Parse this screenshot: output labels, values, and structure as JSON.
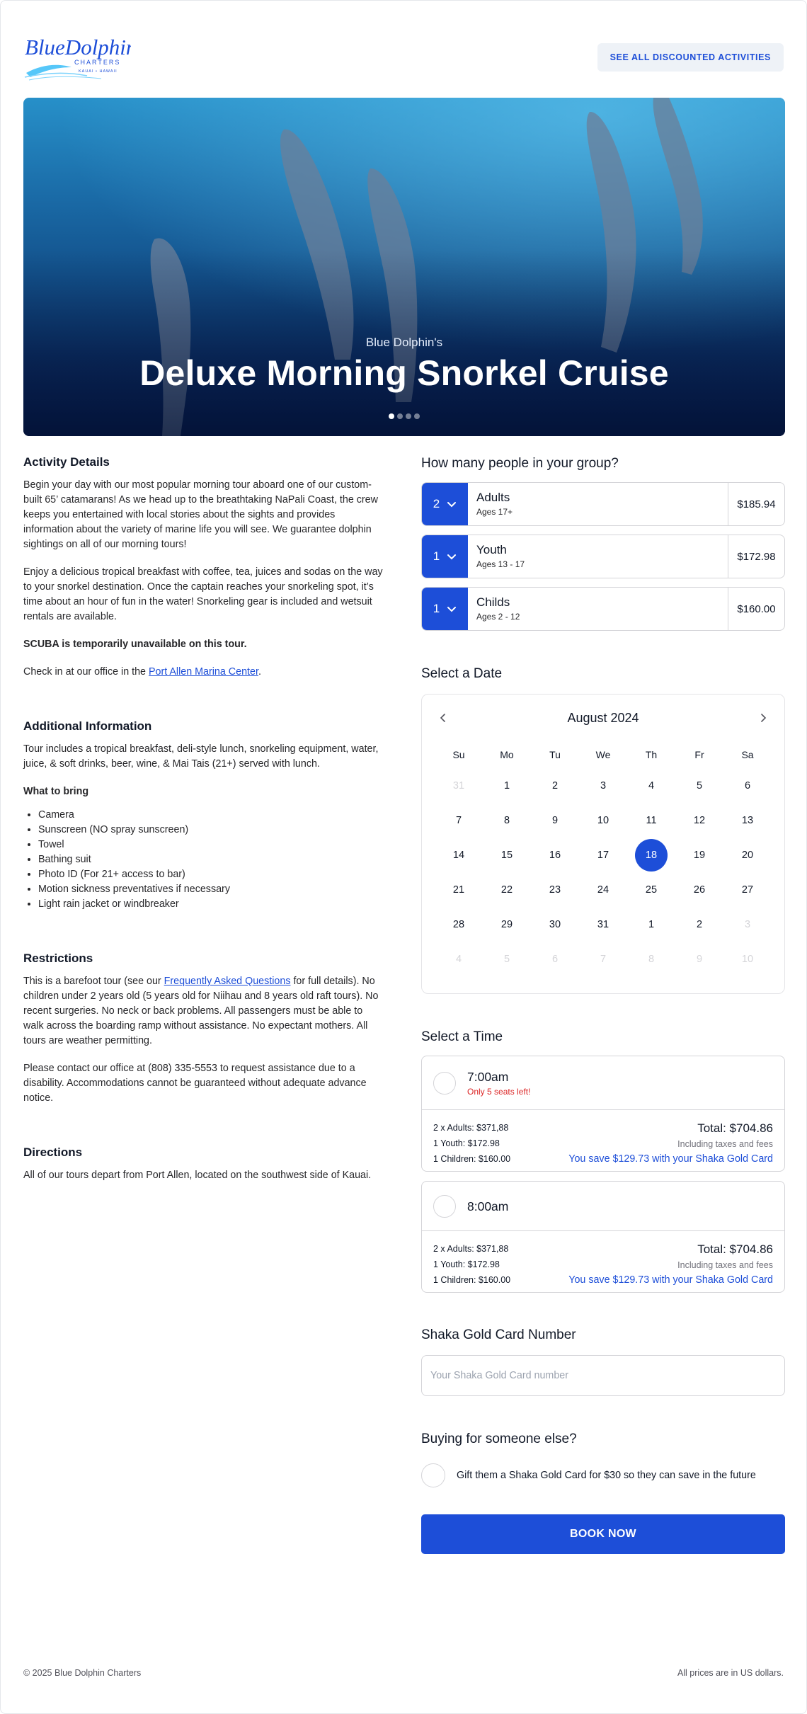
{
  "header": {
    "logo_text": "BlueDolphin",
    "logo_sub": "CHARTERS",
    "logo_tag": "KAUAI • HAWAII",
    "discount_button": "SEE ALL DISCOUNTED ACTIVITIES"
  },
  "hero": {
    "subtitle": "Blue Dolphin's",
    "title": "Deluxe Morning Snorkel Cruise",
    "slide_count": 4,
    "active_slide": 1
  },
  "details": {
    "activity_heading": "Activity Details",
    "p1": "Begin your day with our most popular morning tour aboard one of our custom-built 65’ catamarans! As we head up to the breathtaking NaPali Coast, the crew keeps you entertained with local stories about the sights and provides information about the variety of marine life you will see. We guarantee dolphin sightings on all of our morning tours!",
    "p2": "Enjoy a delicious tropical breakfast with coffee, tea, juices and sodas on the way to your snorkel destination. Once the captain reaches your snorkeling spot, it’s time about an hour of fun in the water! Snorkeling gear is included and wetsuit rentals are available.",
    "scuba_note": "SCUBA is temporarily unavailable on this tour.",
    "checkin_prefix": "Check in at our office in the ",
    "checkin_link": "Port Allen Marina Center",
    "checkin_suffix": ".",
    "additional_heading": "Additional Information",
    "additional_text": "Tour includes a tropical breakfast, deli-style lunch, snorkeling equipment, water, juice, & soft drinks, beer, wine, & Mai Tais (21+) served with lunch.",
    "bring_heading": "What to bring",
    "bring_items": [
      "Camera",
      "Sunscreen (NO spray sunscreen)",
      "Towel",
      "Bathing suit",
      "Photo ID (For 21+ access to bar)",
      "Motion sickness preventatives if necessary",
      "Light rain jacket or windbreaker"
    ],
    "restrictions_heading": "Restrictions",
    "restrictions_prefix": "This is a barefoot tour (see our ",
    "restrictions_link": "Frequently Asked Questions",
    "restrictions_suffix": " for full details). No children under 2 years old (5 years old for Niihau and 8 years old raft tours). No recent surgeries. No neck or back problems. All passengers must be able to walk across the boarding ramp without assistance. No expectant mothers. All tours are weather permitting.",
    "contact_text": "Please contact our office at (808) 335-5553 to request assistance due to a disability. Accommodations cannot be guaranteed without adequate advance notice.",
    "directions_heading": "Directions",
    "directions_text": "All of our tours depart from Port Allen, located on the southwest side of Kauai."
  },
  "group": {
    "heading": "How many people in your group?",
    "rows": [
      {
        "qty": "2",
        "name": "Adults",
        "ages": "Ages 17+",
        "price": "$185.94"
      },
      {
        "qty": "1",
        "name": "Youth",
        "ages": "Ages 13 - 17",
        "price": "$172.98"
      },
      {
        "qty": "1",
        "name": "Childs",
        "ages": "Ages 2 - 12",
        "price": "$160.00"
      }
    ]
  },
  "date": {
    "heading": "Select a Date",
    "month": "August 2024",
    "weekdays": [
      "Su",
      "Mo",
      "Tu",
      "We",
      "Th",
      "Fr",
      "Sa"
    ],
    "days": [
      {
        "d": "31",
        "muted": true
      },
      {
        "d": "1"
      },
      {
        "d": "2"
      },
      {
        "d": "3"
      },
      {
        "d": "4"
      },
      {
        "d": "5"
      },
      {
        "d": "6"
      },
      {
        "d": "7"
      },
      {
        "d": "8"
      },
      {
        "d": "9"
      },
      {
        "d": "10"
      },
      {
        "d": "11"
      },
      {
        "d": "12"
      },
      {
        "d": "13"
      },
      {
        "d": "14"
      },
      {
        "d": "15"
      },
      {
        "d": "16"
      },
      {
        "d": "17"
      },
      {
        "d": "18",
        "selected": true
      },
      {
        "d": "19"
      },
      {
        "d": "20"
      },
      {
        "d": "21"
      },
      {
        "d": "22"
      },
      {
        "d": "23"
      },
      {
        "d": "24"
      },
      {
        "d": "25"
      },
      {
        "d": "26"
      },
      {
        "d": "27"
      },
      {
        "d": "28"
      },
      {
        "d": "29"
      },
      {
        "d": "30"
      },
      {
        "d": "31"
      },
      {
        "d": "1"
      },
      {
        "d": "2"
      },
      {
        "d": "3",
        "muted": true
      },
      {
        "d": "4",
        "muted": true
      },
      {
        "d": "5",
        "muted": true
      },
      {
        "d": "6",
        "muted": true
      },
      {
        "d": "7",
        "muted": true
      },
      {
        "d": "8",
        "muted": true
      },
      {
        "d": "9",
        "muted": true
      },
      {
        "d": "10",
        "muted": true
      }
    ]
  },
  "time": {
    "heading": "Select a Time",
    "slots": [
      {
        "label": "7:00am",
        "seats": "Only 5 seats left!",
        "adults": "2 x Adults: $371,88",
        "youth": "1 Youth: $172.98",
        "children": "1 Children: $160.00",
        "total": "Total: $704.86",
        "incl": "Including taxes and fees",
        "save": "You save $129.73 with your Shaka Gold Card"
      },
      {
        "label": "8:00am",
        "seats": "",
        "adults": "2 x Adults: $371,88",
        "youth": "1 Youth: $172.98",
        "children": "1 Children: $160.00",
        "total": "Total: $704.86",
        "incl": "Including taxes and fees",
        "save": "You save $129.73 with your Shaka Gold Card"
      }
    ]
  },
  "gold_card": {
    "heading": "Shaka Gold Card Number",
    "placeholder": "Your Shaka Gold Card number",
    "value": ""
  },
  "gift": {
    "heading": "Buying for someone else?",
    "label": "Gift them a Shaka Gold Card for $30 so they can save in the future"
  },
  "book_button": "BOOK NOW",
  "footer": {
    "copyright": "© 2025 Blue Dolphin Charters",
    "currency_note": "All prices are in US dollars."
  },
  "colors": {
    "accent": "#1d4ed8",
    "warning": "#dc2626",
    "hero_top": "#2790c9",
    "hero_bottom": "#061d4f"
  }
}
